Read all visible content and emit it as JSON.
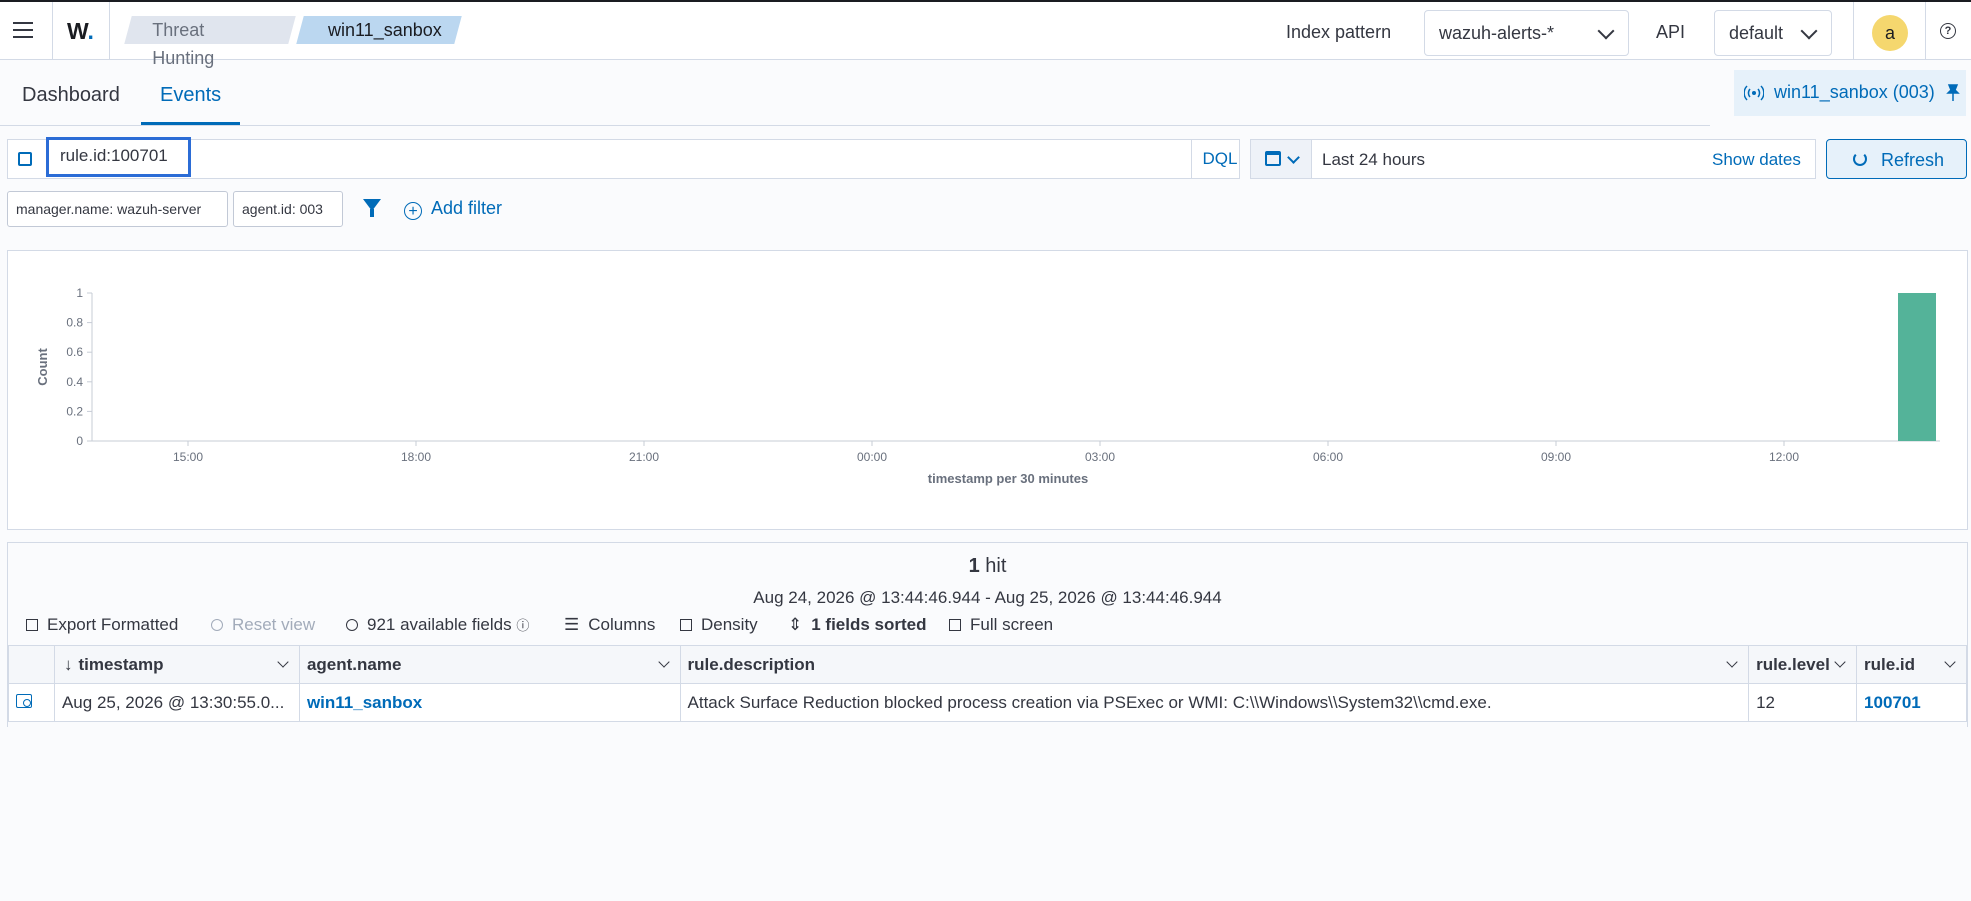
{
  "header": {
    "logo": "W",
    "breadcrumbs": [
      "Threat Hunting",
      "win11_sanbox"
    ],
    "index_pattern_label": "Index pattern",
    "index_pattern_value": "wazuh-alerts-*",
    "api_label": "API",
    "api_value": "default",
    "avatar": "a",
    "help": "?"
  },
  "tabs": [
    "Dashboard",
    "Events"
  ],
  "active_tab": "Events",
  "agent_badge": "win11_sanbox (003)",
  "search": {
    "query": "rule.id:100701",
    "language": "DQL",
    "date_range": "Last 24 hours",
    "show_dates": "Show dates",
    "refresh": "Refresh"
  },
  "filters": {
    "pills": [
      "manager.name: wazuh-server",
      "agent.id: 003"
    ],
    "add_filter": "Add filter"
  },
  "chart_data": {
    "type": "bar",
    "x": [
      "13:30"
    ],
    "values": [
      1
    ],
    "xticks": [
      "15:00",
      "18:00",
      "21:00",
      "00:00",
      "03:00",
      "06:00",
      "09:00",
      "12:00"
    ],
    "yticks": [
      "0",
      "0.2",
      "0.4",
      "0.6",
      "0.8",
      "1"
    ],
    "xlabel": "timestamp per 30 minutes",
    "ylabel": "Count",
    "ylim": [
      0,
      1
    ],
    "bar_color": "#54b399"
  },
  "results": {
    "hits_count": "1",
    "hits_label": "hit",
    "range": "Aug 24, 2026 @ 13:44:46.944 - Aug 25, 2026 @ 13:44:46.944",
    "toolbar": {
      "export": "Export Formatted",
      "reset": "Reset view",
      "fields": "921 available fields",
      "columns": "Columns",
      "density": "Density",
      "sorted": "1 fields sorted",
      "fullscreen": "Full screen"
    },
    "columns": [
      "timestamp",
      "agent.name",
      "rule.description",
      "rule.level",
      "rule.id"
    ],
    "rows": [
      {
        "timestamp": "Aug 25, 2026 @ 13:30:55.0...",
        "agent_name": "win11_sanbox",
        "rule_description": "Attack Surface Reduction blocked process creation via PSExec or WMI: C:\\\\Windows\\\\System32\\\\cmd.exe.",
        "rule_level": "12",
        "rule_id": "100701"
      }
    ]
  },
  "colors": {
    "accent": "#006bb8",
    "bar": "#54b399",
    "query_highlight": "#2b6cd6"
  }
}
